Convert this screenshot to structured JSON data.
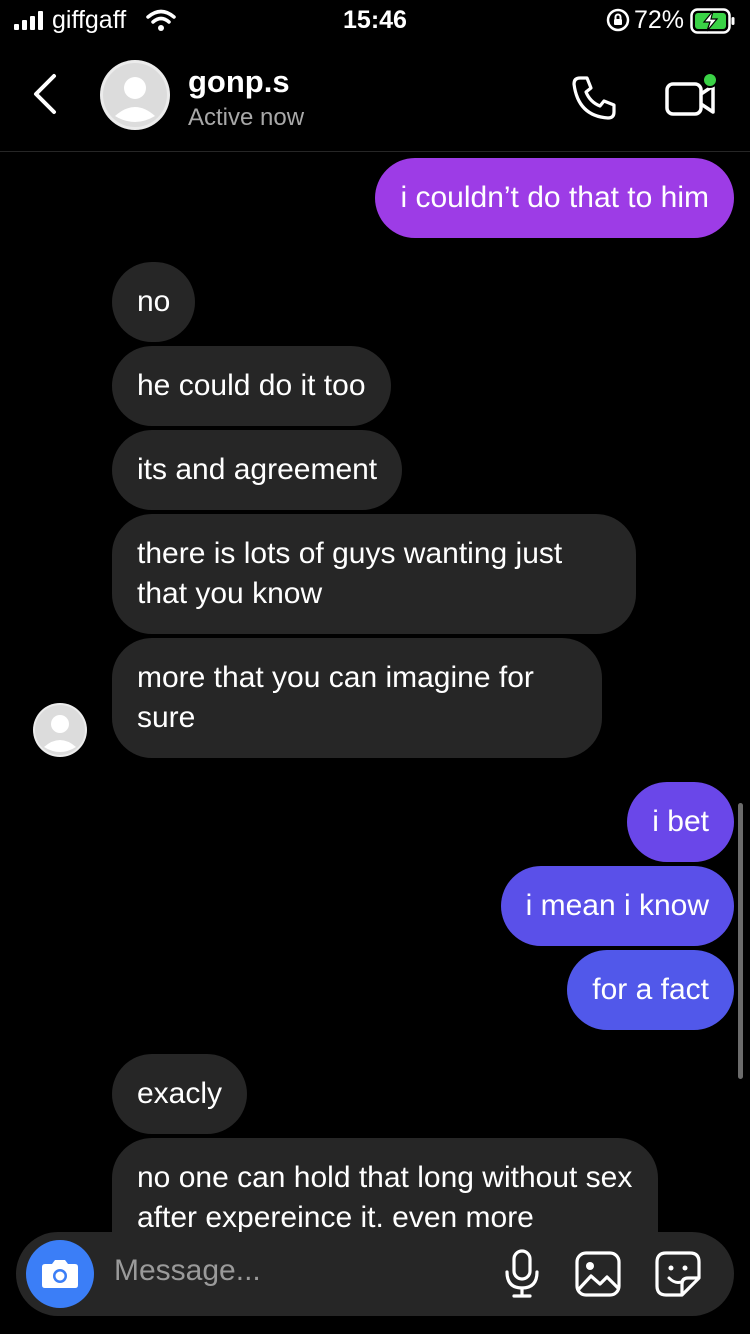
{
  "status_bar": {
    "carrier": "giffgaff",
    "time": "15:46",
    "battery": "72%"
  },
  "header": {
    "name": "gonp.s",
    "status": "Active now"
  },
  "messages": [
    {
      "side": "out",
      "text": "i couldn’t do that to him"
    },
    {
      "side": "in",
      "text": "no"
    },
    {
      "side": "in",
      "text": "he could do it too"
    },
    {
      "side": "in",
      "text": "its and agreement"
    },
    {
      "side": "in",
      "text": "there is lots of guys wanting just that you know"
    },
    {
      "side": "in",
      "text": "more that you can imagine for sure"
    },
    {
      "side": "out",
      "text": "i bet"
    },
    {
      "side": "out",
      "text": "i mean i know"
    },
    {
      "side": "out",
      "text": "for a fact"
    },
    {
      "side": "in",
      "text": "exacly"
    },
    {
      "side": "in",
      "text": "no one can hold that long without sex after expereince it. even more"
    }
  ],
  "composer": {
    "placeholder": "Message..."
  },
  "icons": [
    "signal-icon",
    "wifi-icon",
    "orientation-lock-icon",
    "battery-charging-icon",
    "back-icon",
    "avatar",
    "phone-icon",
    "video-camera-icon",
    "camera-icon",
    "microphone-icon",
    "gallery-icon",
    "sticker-icon"
  ],
  "colors": {
    "background": "#000000",
    "incoming_bubble": "#262626",
    "outgoing_bubble_top": "#9d3ce6",
    "outgoing_bubble_bottom": "#5158ea",
    "camera_button": "#3b7ef7",
    "active_dot": "#3ad246"
  }
}
